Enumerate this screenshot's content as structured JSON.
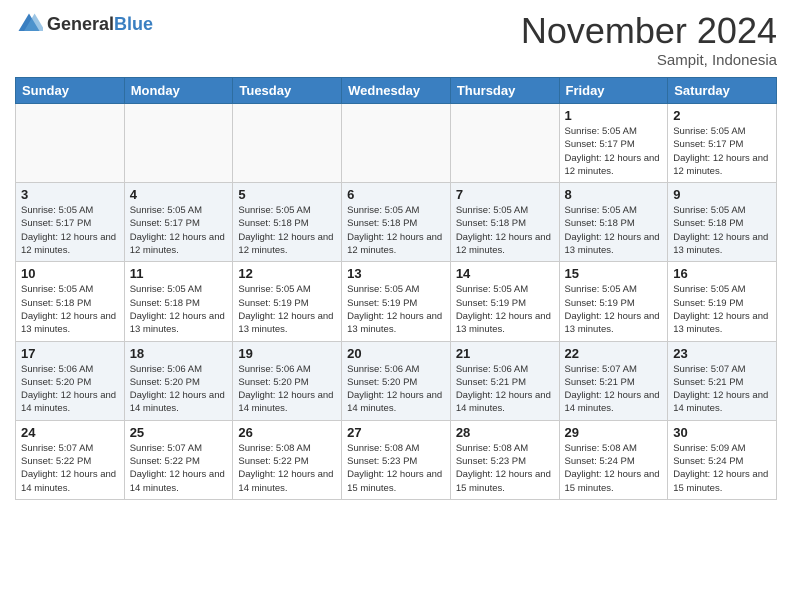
{
  "header": {
    "logo_general": "General",
    "logo_blue": "Blue",
    "month_title": "November 2024",
    "location": "Sampit, Indonesia"
  },
  "weekdays": [
    "Sunday",
    "Monday",
    "Tuesday",
    "Wednesday",
    "Thursday",
    "Friday",
    "Saturday"
  ],
  "rows": [
    {
      "cells": [
        {
          "empty": true
        },
        {
          "empty": true
        },
        {
          "empty": true
        },
        {
          "empty": true
        },
        {
          "empty": true
        },
        {
          "day": 1,
          "sunrise": "5:05 AM",
          "sunset": "5:17 PM",
          "daylight": "12 hours and 12 minutes."
        },
        {
          "day": 2,
          "sunrise": "5:05 AM",
          "sunset": "5:17 PM",
          "daylight": "12 hours and 12 minutes."
        }
      ]
    },
    {
      "cells": [
        {
          "day": 3,
          "sunrise": "5:05 AM",
          "sunset": "5:17 PM",
          "daylight": "12 hours and 12 minutes."
        },
        {
          "day": 4,
          "sunrise": "5:05 AM",
          "sunset": "5:17 PM",
          "daylight": "12 hours and 12 minutes."
        },
        {
          "day": 5,
          "sunrise": "5:05 AM",
          "sunset": "5:18 PM",
          "daylight": "12 hours and 12 minutes."
        },
        {
          "day": 6,
          "sunrise": "5:05 AM",
          "sunset": "5:18 PM",
          "daylight": "12 hours and 12 minutes."
        },
        {
          "day": 7,
          "sunrise": "5:05 AM",
          "sunset": "5:18 PM",
          "daylight": "12 hours and 12 minutes."
        },
        {
          "day": 8,
          "sunrise": "5:05 AM",
          "sunset": "5:18 PM",
          "daylight": "12 hours and 13 minutes."
        },
        {
          "day": 9,
          "sunrise": "5:05 AM",
          "sunset": "5:18 PM",
          "daylight": "12 hours and 13 minutes."
        }
      ]
    },
    {
      "cells": [
        {
          "day": 10,
          "sunrise": "5:05 AM",
          "sunset": "5:18 PM",
          "daylight": "12 hours and 13 minutes."
        },
        {
          "day": 11,
          "sunrise": "5:05 AM",
          "sunset": "5:18 PM",
          "daylight": "12 hours and 13 minutes."
        },
        {
          "day": 12,
          "sunrise": "5:05 AM",
          "sunset": "5:19 PM",
          "daylight": "12 hours and 13 minutes."
        },
        {
          "day": 13,
          "sunrise": "5:05 AM",
          "sunset": "5:19 PM",
          "daylight": "12 hours and 13 minutes."
        },
        {
          "day": 14,
          "sunrise": "5:05 AM",
          "sunset": "5:19 PM",
          "daylight": "12 hours and 13 minutes."
        },
        {
          "day": 15,
          "sunrise": "5:05 AM",
          "sunset": "5:19 PM",
          "daylight": "12 hours and 13 minutes."
        },
        {
          "day": 16,
          "sunrise": "5:05 AM",
          "sunset": "5:19 PM",
          "daylight": "12 hours and 13 minutes."
        }
      ]
    },
    {
      "cells": [
        {
          "day": 17,
          "sunrise": "5:06 AM",
          "sunset": "5:20 PM",
          "daylight": "12 hours and 14 minutes."
        },
        {
          "day": 18,
          "sunrise": "5:06 AM",
          "sunset": "5:20 PM",
          "daylight": "12 hours and 14 minutes."
        },
        {
          "day": 19,
          "sunrise": "5:06 AM",
          "sunset": "5:20 PM",
          "daylight": "12 hours and 14 minutes."
        },
        {
          "day": 20,
          "sunrise": "5:06 AM",
          "sunset": "5:20 PM",
          "daylight": "12 hours and 14 minutes."
        },
        {
          "day": 21,
          "sunrise": "5:06 AM",
          "sunset": "5:21 PM",
          "daylight": "12 hours and 14 minutes."
        },
        {
          "day": 22,
          "sunrise": "5:07 AM",
          "sunset": "5:21 PM",
          "daylight": "12 hours and 14 minutes."
        },
        {
          "day": 23,
          "sunrise": "5:07 AM",
          "sunset": "5:21 PM",
          "daylight": "12 hours and 14 minutes."
        }
      ]
    },
    {
      "cells": [
        {
          "day": 24,
          "sunrise": "5:07 AM",
          "sunset": "5:22 PM",
          "daylight": "12 hours and 14 minutes."
        },
        {
          "day": 25,
          "sunrise": "5:07 AM",
          "sunset": "5:22 PM",
          "daylight": "12 hours and 14 minutes."
        },
        {
          "day": 26,
          "sunrise": "5:08 AM",
          "sunset": "5:22 PM",
          "daylight": "12 hours and 14 minutes."
        },
        {
          "day": 27,
          "sunrise": "5:08 AM",
          "sunset": "5:23 PM",
          "daylight": "12 hours and 15 minutes."
        },
        {
          "day": 28,
          "sunrise": "5:08 AM",
          "sunset": "5:23 PM",
          "daylight": "12 hours and 15 minutes."
        },
        {
          "day": 29,
          "sunrise": "5:08 AM",
          "sunset": "5:24 PM",
          "daylight": "12 hours and 15 minutes."
        },
        {
          "day": 30,
          "sunrise": "5:09 AM",
          "sunset": "5:24 PM",
          "daylight": "12 hours and 15 minutes."
        }
      ]
    }
  ],
  "labels": {
    "sunrise_prefix": "Sunrise: ",
    "sunset_prefix": "Sunset: ",
    "daylight_prefix": "Daylight: "
  }
}
